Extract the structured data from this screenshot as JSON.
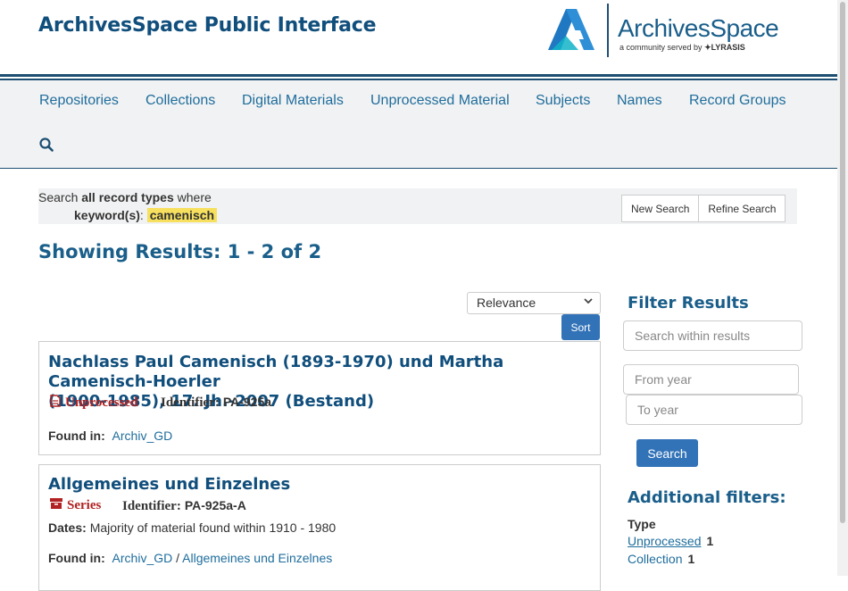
{
  "header": {
    "site_title": "ArchivesSpace Public Interface",
    "logo_text": "ArchivesSpace",
    "logo_tagline": "a community served by",
    "logo_partner": "LYRASIS"
  },
  "nav": {
    "items": [
      "Repositories",
      "Collections",
      "Digital Materials",
      "Unprocessed Material",
      "Subjects",
      "Names",
      "Record Groups"
    ],
    "search_icon": "search-icon"
  },
  "search_summary": {
    "prefix": "Search",
    "scope": "all record types",
    "suffix": "where",
    "field_label": "keyword(s)",
    "term": "camenisch",
    "new_search_label": "New Search",
    "refine_search_label": "Refine Search"
  },
  "results": {
    "heading": "Showing Results: 1 - 2 of 2",
    "sort_value": "Relevance",
    "sort_button": "Sort",
    "items": [
      {
        "title_line1": "Nachlass Paul Camenisch (1893-1970) und Martha Camenisch-Hoerler",
        "title_line2": "(1900-1985), 17. Jh.-2007 (Bestand)",
        "badge": "Unprocessed",
        "badge_icon": "file-icon",
        "identifier_label": "Identifier:",
        "identifier": "PA-925a",
        "found_in_label": "Found in:",
        "found_in": [
          "Archiv_GD"
        ]
      },
      {
        "title_line1": "Allgemeines und Einzelnes",
        "badge": "Series",
        "badge_icon": "folder-icon",
        "identifier_label": "Identifier:",
        "identifier": "PA-925a-A",
        "dates_label": "Dates:",
        "dates": "Majority of material found within 1910 - 1980",
        "found_in_label": "Found in:",
        "found_in": [
          "Archiv_GD",
          "Allgemeines und Einzelnes"
        ],
        "found_in_separator": "/"
      }
    ]
  },
  "filters": {
    "heading": "Filter Results",
    "search_within_placeholder": "Search within results",
    "from_year_placeholder": "From year",
    "to_year_placeholder": "To year",
    "search_button": "Search",
    "additional_heading": "Additional filters:",
    "type_label": "Type",
    "facets": [
      {
        "label": "Unprocessed",
        "count": "1"
      },
      {
        "label": "Collection",
        "count": "1"
      }
    ]
  },
  "colors": {
    "brand_navy": "#104e7c",
    "link_blue": "#1f6d9c",
    "button_blue": "#3273b8",
    "highlight": "#f6e05e",
    "badge_red": "#b22222"
  }
}
